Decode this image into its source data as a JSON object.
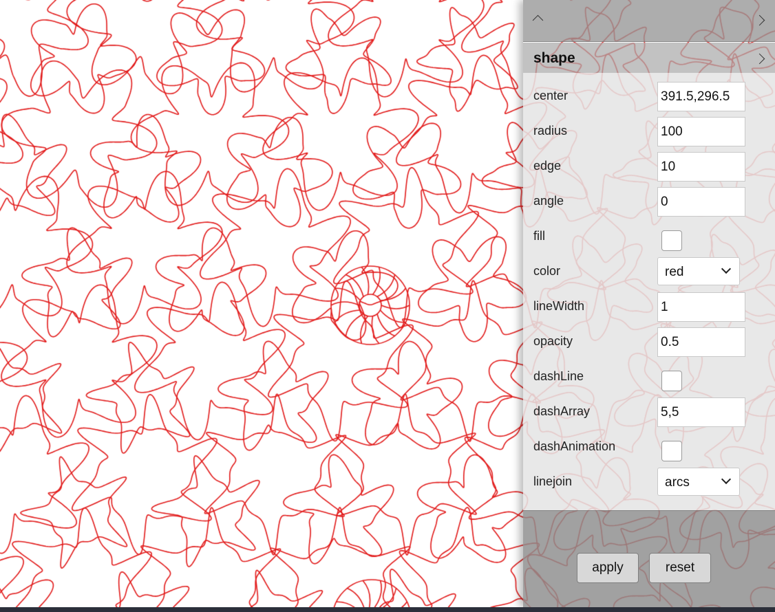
{
  "colors": {
    "stroke": "#e21a1a",
    "background": "#ffffff",
    "panel_topbar": "#969696",
    "panel_fields": "#e4e4e4",
    "panel_footer": "#8c8c8c"
  },
  "panel": {
    "section_title": "shape",
    "fields": [
      {
        "label": "center",
        "type": "text",
        "value": "391.5,296.5"
      },
      {
        "label": "radius",
        "type": "text",
        "value": "100"
      },
      {
        "label": "edge",
        "type": "text",
        "value": "10"
      },
      {
        "label": "angle",
        "type": "text",
        "value": "0"
      },
      {
        "label": "fill",
        "type": "checkbox",
        "checked": false
      },
      {
        "label": "color",
        "type": "select",
        "value": "red"
      },
      {
        "label": "lineWidth",
        "type": "text",
        "value": "1"
      },
      {
        "label": "opacity",
        "type": "text",
        "value": "0.5"
      },
      {
        "label": "dashLine",
        "type": "checkbox",
        "checked": false
      },
      {
        "label": "dashArray",
        "type": "text",
        "value": "5,5"
      },
      {
        "label": "dashAnimation",
        "type": "checkbox",
        "checked": false
      },
      {
        "label": "linejoin",
        "type": "select",
        "value": "arcs"
      }
    ],
    "apply_label": "apply",
    "reset_label": "reset"
  },
  "icons": {
    "collapse": "chevron-up-icon",
    "topbar_next": "chevron-right-icon",
    "section": "chevron-right-icon"
  }
}
